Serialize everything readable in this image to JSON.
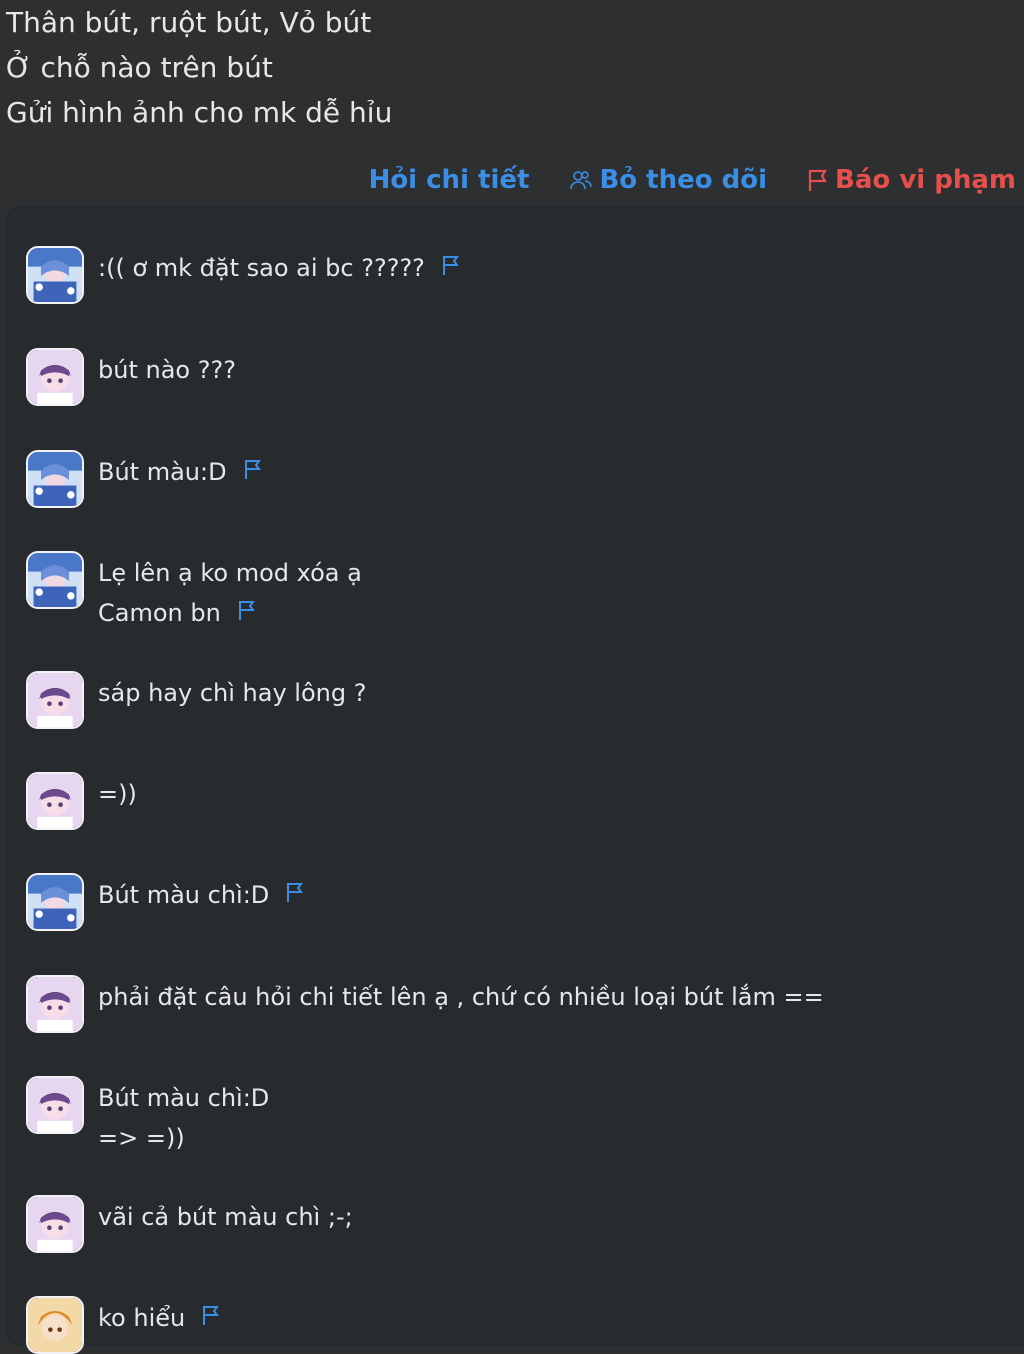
{
  "question": {
    "lines": [
      "Thân bút, ruột bút,  Vỏ bút",
      "Ở chỗ nào trên bút",
      "Gửi hình ảnh cho mk dễ hỉu"
    ]
  },
  "actions": {
    "ask_detail": "Hỏi chi tiết",
    "unfollow": "Bỏ theo dõi",
    "report": "Báo vi phạm"
  },
  "colors": {
    "background": "#2d2f31",
    "panel": "#282b2e",
    "text": "#e6e7e8",
    "link_blue": "#3a8ee6",
    "report_red": "#e6504c"
  },
  "comments": [
    {
      "avatar": "blue-anime-avatar",
      "lines": [
        ":(( ơ mk đặt sao ai bc ?????"
      ],
      "flag": true
    },
    {
      "avatar": "purple-anime-avatar",
      "lines": [
        "bút nào ???"
      ],
      "flag": false
    },
    {
      "avatar": "blue-anime-avatar",
      "lines": [
        "Bút màu:D"
      ],
      "flag": true
    },
    {
      "avatar": "blue-anime-avatar",
      "lines": [
        "Lẹ lên ạ ko mod xóa ạ",
        "Camon bn"
      ],
      "flag": true
    },
    {
      "avatar": "purple-anime-avatar",
      "lines": [
        "sáp hay chì hay lông ?"
      ],
      "flag": false
    },
    {
      "avatar": "purple-anime-avatar",
      "lines": [
        "=))"
      ],
      "flag": false
    },
    {
      "avatar": "blue-anime-avatar",
      "lines": [
        "Bút màu chì:D"
      ],
      "flag": true
    },
    {
      "avatar": "purple-anime-avatar",
      "lines": [
        "phải đặt câu hỏi chi tiết lên ạ , chứ có nhiều loại bút lắm =="
      ],
      "flag": false
    },
    {
      "avatar": "purple-anime-avatar",
      "lines": [
        "Bút màu chì:D",
        "=> =))"
      ],
      "flag": false
    },
    {
      "avatar": "purple-anime-avatar",
      "lines": [
        "vãi cả bút màu chì ;-;"
      ],
      "flag": false
    },
    {
      "avatar": "orange-anime-avatar",
      "lines": [
        "ko hiểu"
      ],
      "flag": true
    }
  ]
}
